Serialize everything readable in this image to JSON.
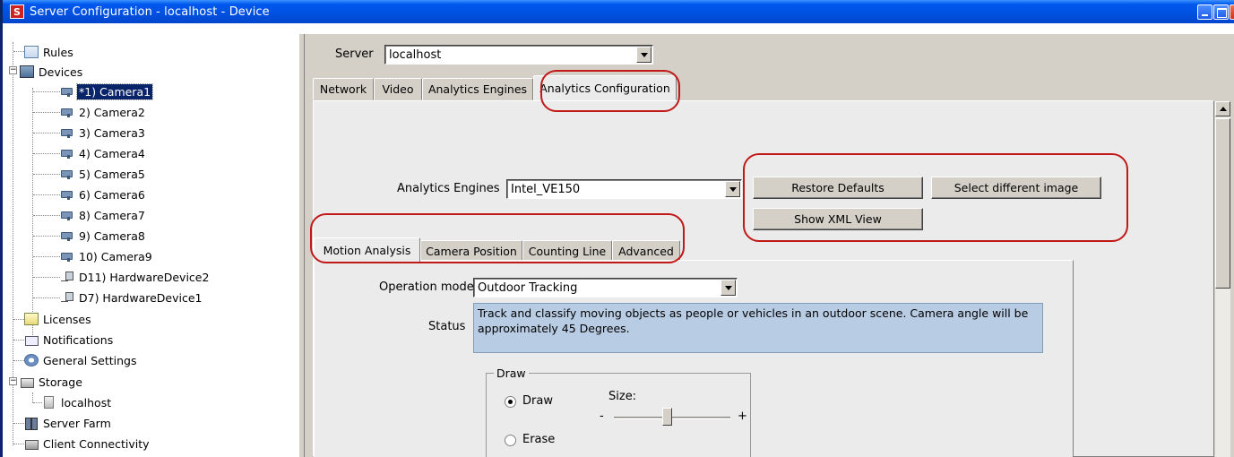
{
  "window": {
    "title": "Server Configuration - localhost - Device",
    "app_icon": "S"
  },
  "tree": {
    "items": [
      {
        "label": "Rules",
        "icon": "rules-icon"
      },
      {
        "label": "Devices",
        "icon": "devices-icon"
      },
      {
        "label": "*1) Camera1",
        "icon": "camera-icon"
      },
      {
        "label": "2) Camera2",
        "icon": "camera-icon"
      },
      {
        "label": "3) Camera3",
        "icon": "camera-icon"
      },
      {
        "label": "4) Camera4",
        "icon": "camera-icon"
      },
      {
        "label": "5) Camera5",
        "icon": "camera-icon"
      },
      {
        "label": "6) Camera6",
        "icon": "camera-icon"
      },
      {
        "label": "8) Camera7",
        "icon": "camera-icon"
      },
      {
        "label": "9) Camera8",
        "icon": "camera-icon"
      },
      {
        "label": "10) Camera9",
        "icon": "camera-icon"
      },
      {
        "label": "D11) HardwareDevice2",
        "icon": "hardware-device-icon"
      },
      {
        "label": "D7) HardwareDevice1",
        "icon": "hardware-device-icon"
      },
      {
        "label": "Licenses",
        "icon": "licenses-icon"
      },
      {
        "label": "Notifications",
        "icon": "notifications-icon"
      },
      {
        "label": "General Settings",
        "icon": "general-settings-icon"
      },
      {
        "label": "Storage",
        "icon": "storage-icon"
      },
      {
        "label": "localhost",
        "icon": "host-icon"
      },
      {
        "label": "Server Farm",
        "icon": "server-farm-icon"
      },
      {
        "label": "Client Connectivity",
        "icon": "client-connectivity-icon"
      }
    ],
    "selected": "*1) Camera1"
  },
  "server": {
    "label": "Server",
    "value": "localhost"
  },
  "tabs": [
    {
      "label": "Network"
    },
    {
      "label": "Video"
    },
    {
      "label": "Analytics Engines"
    },
    {
      "label": "Analytics Configuration",
      "active": true
    }
  ],
  "analytics": {
    "engines_label": "Analytics Engines",
    "engines_value": "Intel_VE150",
    "restore_defaults": "Restore Defaults",
    "select_image": "Select different image",
    "show_xml": "Show XML View"
  },
  "subtabs": [
    {
      "label": "Motion Analysis",
      "active": true
    },
    {
      "label": "Camera Position"
    },
    {
      "label": "Counting Line"
    },
    {
      "label": "Advanced"
    }
  ],
  "motion": {
    "operation_mode_label": "Operation mode",
    "operation_mode_value": "Outdoor Tracking",
    "status_label": "Status",
    "status_text": "Track and classify moving objects as people or vehicles in an outdoor scene. Camera angle will be approximately 45 Degrees.",
    "draw_group": "Draw",
    "draw_option": "Draw",
    "erase_option": "Erase",
    "selected_option": "Draw",
    "size_label": "Size:",
    "size_minus": "-",
    "size_plus": "+"
  },
  "colors": {
    "highlight": "#c21818",
    "selection": "#0a246a",
    "status_bg": "#b8cce4"
  }
}
